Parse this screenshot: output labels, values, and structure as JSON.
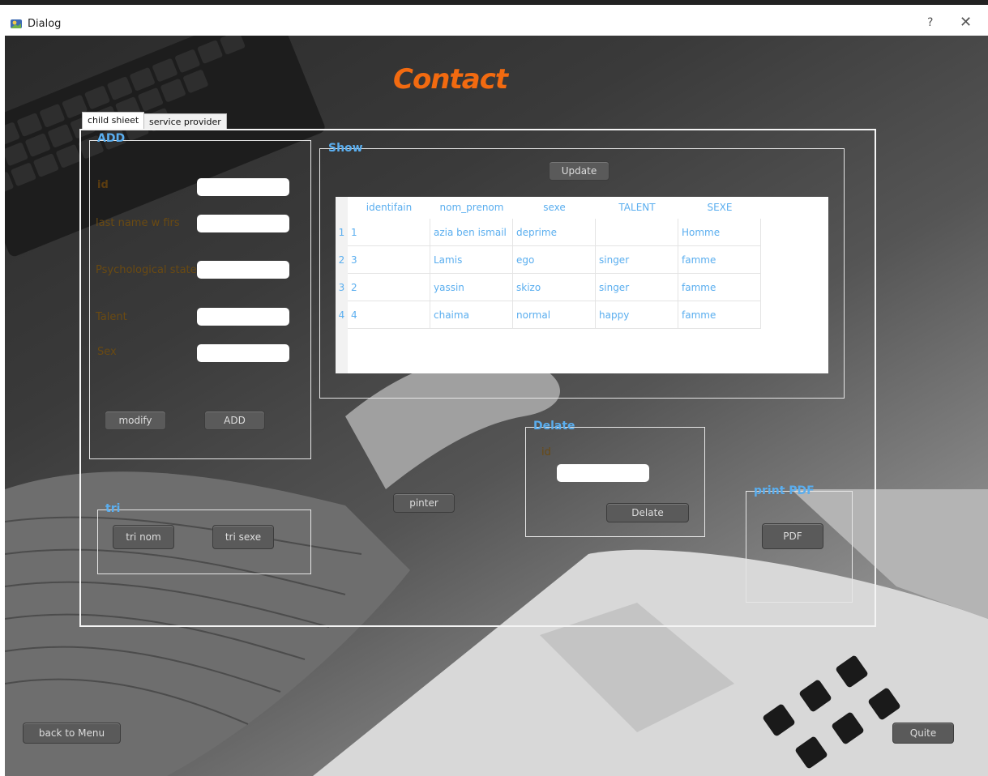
{
  "window": {
    "title": "Dialog",
    "help": "?",
    "close": "✕"
  },
  "heading": "Contact",
  "tabs": [
    {
      "label": "child shieet"
    },
    {
      "label": "service provider"
    }
  ],
  "add_group": {
    "title": "ADD",
    "labels": {
      "id": "id",
      "name": "last name w firs",
      "psych": "Psychological state",
      "talent": "Talent",
      "sex": "Sex"
    },
    "modify": "modify",
    "add": "ADD"
  },
  "tri_group": {
    "title": "tri",
    "tri_nom": "tri nom",
    "tri_sexe": "tri sexe"
  },
  "show_group": {
    "title": "Show",
    "update": "Update"
  },
  "table": {
    "columns": [
      "identifain",
      "nom_prenom",
      "sexe",
      "TALENT",
      "SEXE"
    ],
    "rows": [
      {
        "num": "1",
        "cells": [
          "1",
          "azia ben ismail",
          "deprime",
          "",
          "Homme"
        ]
      },
      {
        "num": "2",
        "cells": [
          "3",
          "Lamis",
          "ego",
          "singer",
          "famme"
        ]
      },
      {
        "num": "3",
        "cells": [
          "2",
          "yassin",
          "skizo",
          "singer",
          "famme"
        ]
      },
      {
        "num": "4",
        "cells": [
          "4",
          "chaima",
          "normal",
          "happy",
          "famme"
        ]
      }
    ]
  },
  "pinter": "pinter",
  "delete_group": {
    "title": "Delate",
    "id_label": "id",
    "button": "Delate"
  },
  "pdf_group": {
    "title": "print PDF",
    "button": "PDF"
  },
  "back": "back to Menu",
  "quit": "Quite",
  "colors": {
    "heading": "#f26a10",
    "group_title": "#5aaeef",
    "label": "#5c3d10",
    "button": "#5a5a5a"
  }
}
